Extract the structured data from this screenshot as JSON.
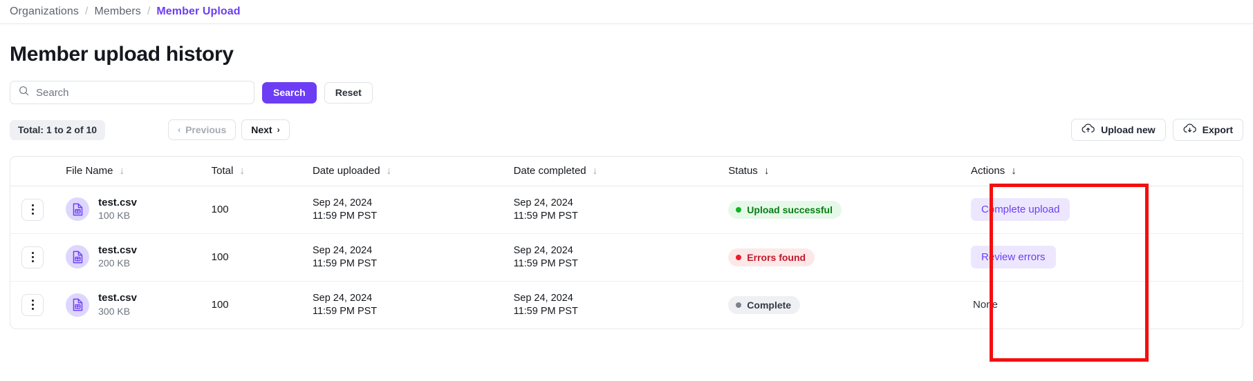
{
  "breadcrumb": {
    "items": [
      {
        "label": "Organizations",
        "current": false
      },
      {
        "label": "Members",
        "current": false
      },
      {
        "label": "Member Upload",
        "current": true
      }
    ],
    "separator": "/"
  },
  "page": {
    "title": "Member upload history"
  },
  "search": {
    "placeholder": "Search",
    "value": "",
    "search_label": "Search",
    "reset_label": "Reset",
    "icon": "search-icon"
  },
  "toolbar": {
    "total_label": "Total: 1 to 2 of 10",
    "previous_label": "Previous",
    "next_label": "Next",
    "previous_chevron": "‹",
    "next_chevron": "›",
    "upload_new_label": "Upload new",
    "upload_new_icon": "cloud-upload-icon",
    "export_label": "Export",
    "export_icon": "cloud-download-icon"
  },
  "table": {
    "sort_arrow": "↓",
    "columns": [
      {
        "key": "kebab",
        "label": ""
      },
      {
        "key": "file",
        "label": "File Name"
      },
      {
        "key": "total",
        "label": "Total"
      },
      {
        "key": "dateup",
        "label": "Date uploaded"
      },
      {
        "key": "datedn",
        "label": "Date completed"
      },
      {
        "key": "status",
        "label": "Status"
      },
      {
        "key": "actions",
        "label": "Actions"
      }
    ],
    "rows": [
      {
        "file_name": "test.csv",
        "file_size": "100 KB",
        "file_icon": "csv-file-icon",
        "total": "100",
        "date_uploaded_date": "Sep 24, 2024",
        "date_uploaded_time": "11:59 PM PST",
        "date_completed_date": "Sep 24, 2024",
        "date_completed_time": "11:59 PM PST",
        "status_label": "Upload successful",
        "status_tone": "green",
        "action_label": "Complete upload",
        "action_type": "chip"
      },
      {
        "file_name": "test.csv",
        "file_size": "200 KB",
        "file_icon": "csv-file-icon",
        "total": "100",
        "date_uploaded_date": "Sep 24, 2024",
        "date_uploaded_time": "11:59 PM PST",
        "date_completed_date": "Sep 24, 2024",
        "date_completed_time": "11:59 PM PST",
        "status_label": "Errors found",
        "status_tone": "red",
        "action_label": "Review errors",
        "action_type": "chip"
      },
      {
        "file_name": "test.csv",
        "file_size": "300 KB",
        "file_icon": "csv-file-icon",
        "total": "100",
        "date_uploaded_date": "Sep 24, 2024",
        "date_uploaded_time": "11:59 PM PST",
        "date_completed_date": "Sep 24, 2024",
        "date_completed_time": "11:59 PM PST",
        "status_label": "Complete",
        "status_tone": "grey",
        "action_label": "None",
        "action_type": "text"
      }
    ]
  },
  "annotation": {
    "color": "#f40f0f",
    "target": "actions-column"
  },
  "colors": {
    "accent": "#6d3df5",
    "accent_soft": "#ece7fe",
    "success": "#12b324",
    "error": "#f01b2c",
    "neutral": "#7c838e",
    "annotation": "#f40f0f"
  }
}
